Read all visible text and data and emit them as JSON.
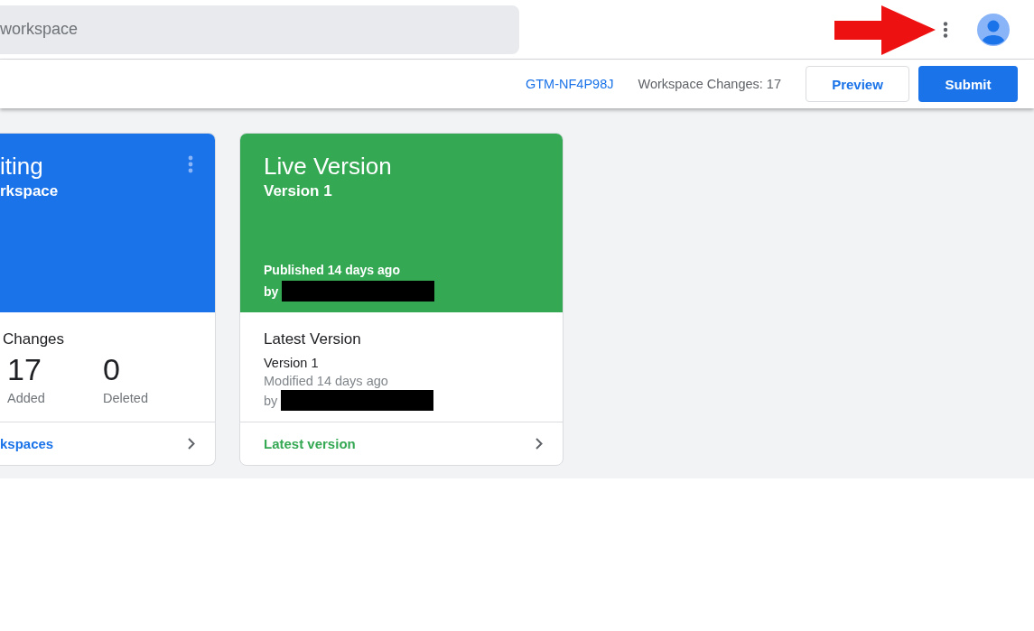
{
  "search": {
    "placeholder": "workspace"
  },
  "action_bar": {
    "container_id": "GTM-NF4P98J",
    "workspace_changes": "Workspace Changes: 17",
    "buttons": [
      {
        "label": "Preview",
        "kind": "outlined"
      },
      {
        "label": "Submit",
        "kind": "filled"
      }
    ]
  },
  "cards": [
    {
      "kind": "workspace",
      "title": "iting",
      "subtitle": "rkspace",
      "section_title": "Changes",
      "stats": [
        {
          "value": "17",
          "label": "Added"
        },
        {
          "value": "0",
          "label": "Deleted"
        }
      ],
      "link": "kspaces"
    },
    {
      "kind": "version",
      "title": "Live Version",
      "subtitle": "Version 1",
      "published": "Published 14 days ago",
      "published_by": "by",
      "section_title": "Latest Version",
      "version": "Version 1",
      "modified": "Modified 14 days ago",
      "modified_by": "by",
      "link": "Latest version"
    }
  ]
}
